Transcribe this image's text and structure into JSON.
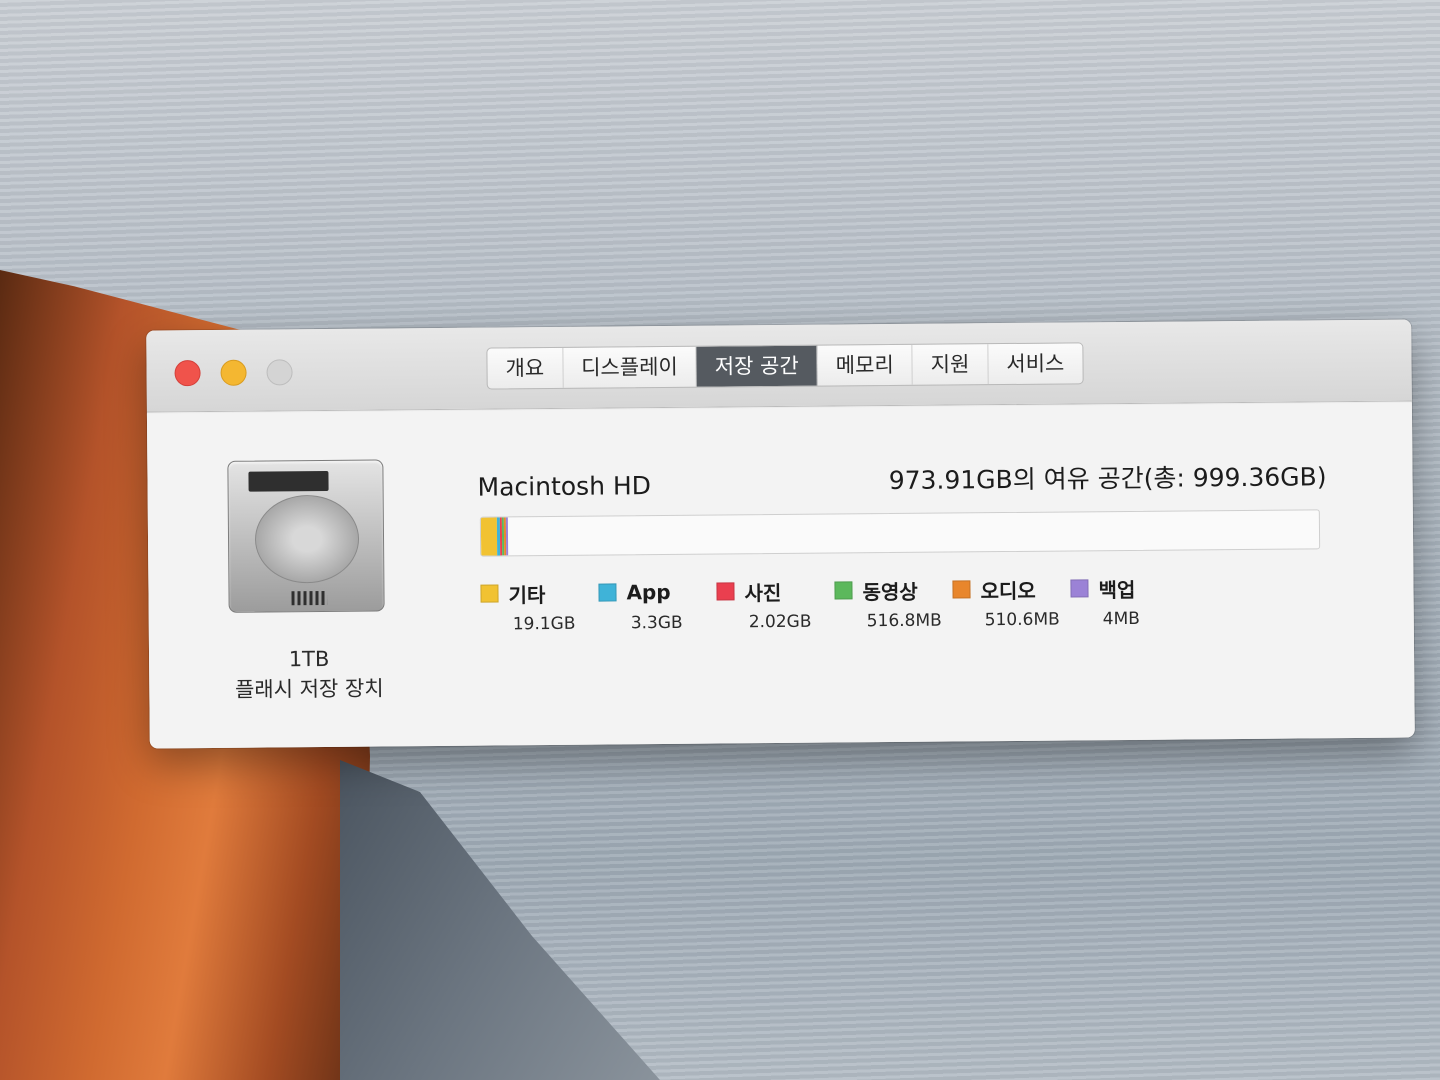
{
  "window": {
    "tabs": [
      {
        "label": "개요",
        "active": false
      },
      {
        "label": "디스플레이",
        "active": false
      },
      {
        "label": "저장 공간",
        "active": true
      },
      {
        "label": "메모리",
        "active": false
      },
      {
        "label": "지원",
        "active": false
      },
      {
        "label": "서비스",
        "active": false
      }
    ]
  },
  "disk": {
    "capacity": "1TB",
    "type": "플래시 저장 장치",
    "icon": "hard-drive-icon"
  },
  "volume": {
    "name": "Macintosh HD",
    "free_text": "973.91GB의 여유 공간(총: 999.36GB)",
    "total_gb": 999.36,
    "free_gb": 973.91
  },
  "categories": [
    {
      "name": "기타",
      "size": "19.1GB",
      "gb": 19.1,
      "color": "#f1c232"
    },
    {
      "name": "App",
      "size": "3.3GB",
      "gb": 3.3,
      "color": "#3fb3d8"
    },
    {
      "name": "사진",
      "size": "2.02GB",
      "gb": 2.02,
      "color": "#ea3f4f"
    },
    {
      "name": "동영상",
      "size": "516.8MB",
      "gb": 0.5168,
      "color": "#5cb85c"
    },
    {
      "name": "오디오",
      "size": "510.6MB",
      "gb": 0.5106,
      "color": "#e8862c"
    },
    {
      "name": "백업",
      "size": "4MB",
      "gb": 0.004,
      "color": "#9b82d6"
    }
  ]
}
